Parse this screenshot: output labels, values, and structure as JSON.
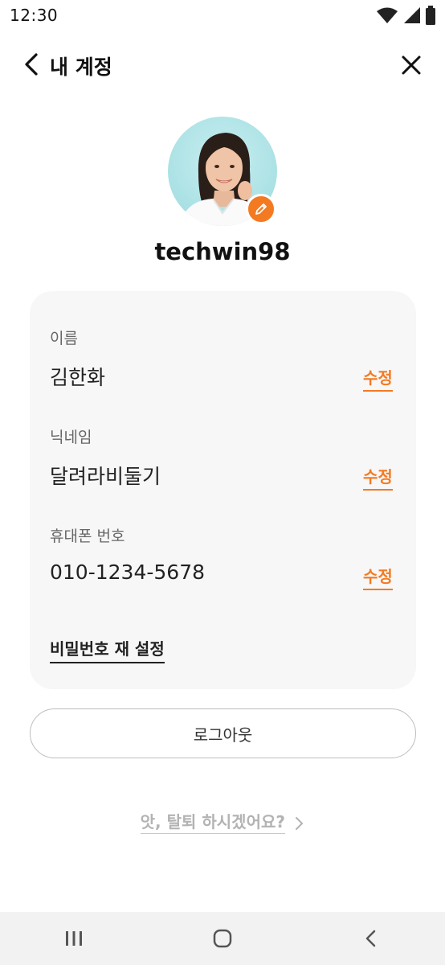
{
  "status_bar": {
    "time": "12:30",
    "icons": [
      "wifi-icon",
      "cell-signal-icon",
      "battery-icon"
    ]
  },
  "header": {
    "title": "내 계정",
    "back_icon": "chevron-left-icon",
    "close_icon": "close-icon"
  },
  "profile": {
    "username": "techwin98",
    "edit_photo_icon": "pencil-icon"
  },
  "account_info": {
    "fields": [
      {
        "label": "이름",
        "value": "김한화",
        "edit_label": "수정"
      },
      {
        "label": "닉네임",
        "value": "달려라비둘기",
        "edit_label": "수정"
      },
      {
        "label": "휴대폰 번호",
        "value": "010-1234-5678",
        "edit_label": "수정"
      }
    ],
    "reset_password_label": "비밀번호 재 설정"
  },
  "logout_label": "로그아웃",
  "withdraw_label": "앗, 탈퇴 하시겠어요?",
  "nav_bar": {
    "icons": [
      "recent-apps-icon",
      "home-icon",
      "back-icon"
    ]
  },
  "colors": {
    "accent": "#f47a22",
    "card_background": "#f7f7f7",
    "muted_text": "#b3b3b3"
  }
}
